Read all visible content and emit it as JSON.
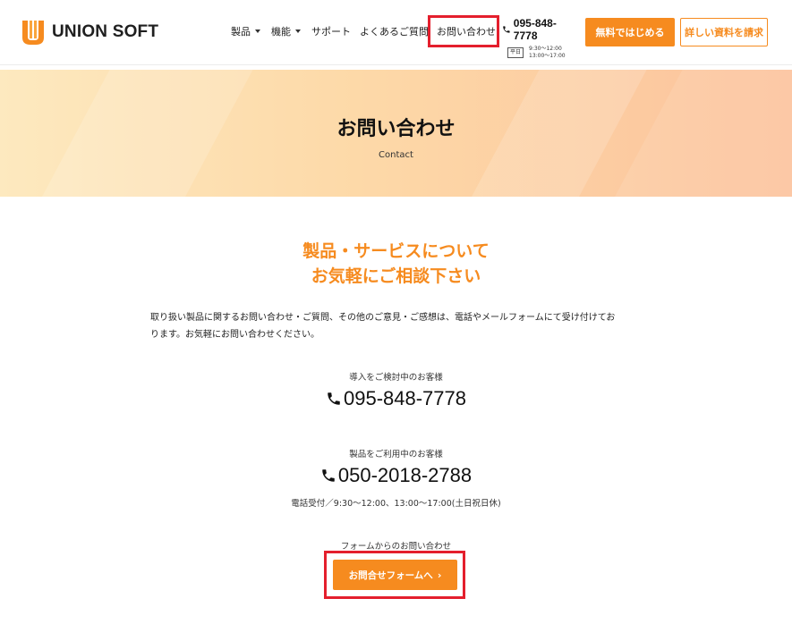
{
  "header": {
    "logo_text": "UNION SOFT",
    "nav": {
      "products": "製品",
      "features": "機能",
      "support": "サポート",
      "faq": "よくあるご質問",
      "contact": "お問い合わせ"
    },
    "phone": "095-848-7778",
    "weekday_badge": "平日",
    "hours_am": "9:30～12:00",
    "hours_pm": "13:00～17:00",
    "free_button": "無料ではじめる",
    "docs_button": "詳しい資料を請求"
  },
  "hero": {
    "title": "お問い合わせ",
    "subtitle": "Contact"
  },
  "content": {
    "heading_line1": "製品・サービスについて",
    "heading_line2": "お気軽にご相談下さい",
    "intro_line1": "取り扱い製品に関するお問い合わせ・ご質問、その他のご意見・ご感想は、電話やメールフォームにて受け付けてお",
    "intro_line2": "ります。お気軽にお問い合わせください。",
    "prospect_label": "導入をご検討中のお客様",
    "prospect_phone": "095-848-7778",
    "customer_label": "製品をご利用中のお客様",
    "customer_phone": "050-2018-2788",
    "hours_note": "電話受付／9:30～12:00、13:00～17:00(土日祝日休)",
    "form_label": "フォームからのお問い合わせ",
    "form_button": "お問合せフォームへ",
    "form_button_chevron": "›"
  },
  "colors": {
    "accent_orange": "#f68b1f",
    "highlight_red": "#e41f2d"
  },
  "icons": [
    "logo-mark-icon",
    "chevron-down-icon",
    "phone-icon",
    "chevron-right-icon"
  ]
}
